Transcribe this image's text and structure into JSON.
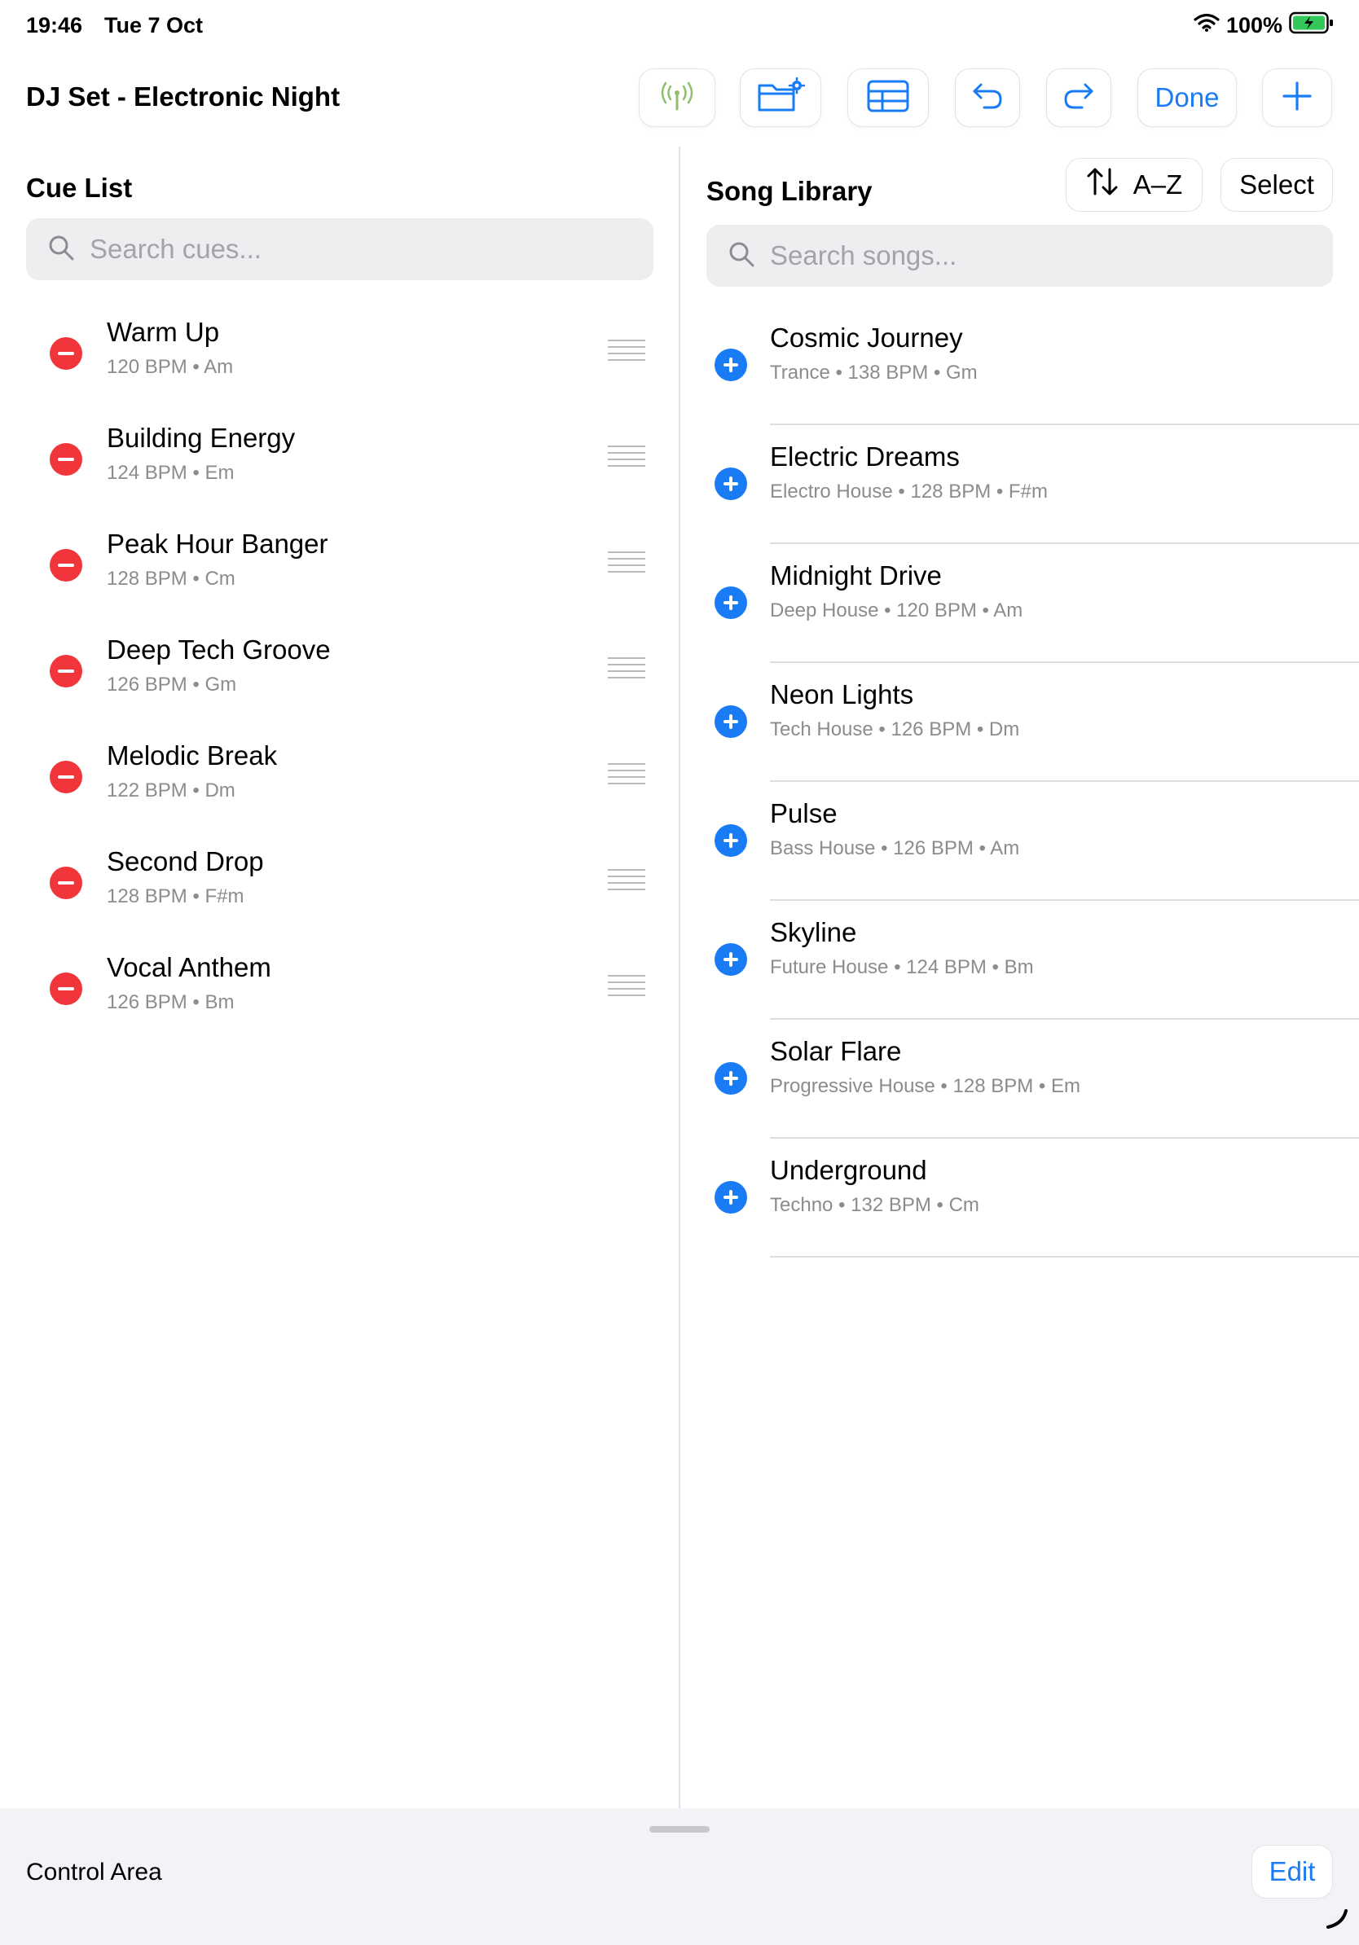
{
  "status_bar": {
    "time": "19:46",
    "date": "Tue 7 Oct",
    "battery_percent": "100%",
    "battery_color": "#32c759"
  },
  "nav": {
    "title": "DJ Set - Electronic Night",
    "icons": [
      "broadcast-icon",
      "folder-settings-icon",
      "table-icon",
      "undo-icon",
      "redo-icon",
      "plus-icon"
    ],
    "done_label": "Done",
    "accent_color": "#1a7cf5",
    "broadcast_color": "#8fbf6a"
  },
  "cue_list": {
    "title": "Cue List",
    "search_placeholder": "Search cues...",
    "items": [
      {
        "name": "Warm Up",
        "meta": "120 BPM • Am"
      },
      {
        "name": "Building Energy",
        "meta": "124 BPM • Em"
      },
      {
        "name": "Peak Hour Banger",
        "meta": "128 BPM • Cm"
      },
      {
        "name": "Deep Tech Groove",
        "meta": "126 BPM • Gm"
      },
      {
        "name": "Melodic Break",
        "meta": "122 BPM • Dm"
      },
      {
        "name": "Second Drop",
        "meta": "128 BPM • F#m"
      },
      {
        "name": "Vocal Anthem",
        "meta": "126 BPM • Bm"
      }
    ]
  },
  "song_library": {
    "title": "Song Library",
    "sort_label": "A–Z",
    "select_label": "Select",
    "search_placeholder": "Search songs...",
    "items": [
      {
        "name": "Cosmic Journey",
        "meta": "Trance • 138 BPM • Gm"
      },
      {
        "name": "Electric Dreams",
        "meta": "Electro House • 128 BPM • F#m"
      },
      {
        "name": "Midnight Drive",
        "meta": "Deep House • 120 BPM • Am"
      },
      {
        "name": "Neon Lights",
        "meta": "Tech House • 126 BPM • Dm"
      },
      {
        "name": "Pulse",
        "meta": "Bass House • 126 BPM • Am"
      },
      {
        "name": "Skyline",
        "meta": "Future House • 124 BPM • Bm"
      },
      {
        "name": "Solar Flare",
        "meta": "Progressive House • 128 BPM • Em"
      },
      {
        "name": "Underground",
        "meta": "Techno • 132 BPM • Cm"
      }
    ]
  },
  "control_area": {
    "label": "Control Area",
    "edit_label": "Edit"
  }
}
